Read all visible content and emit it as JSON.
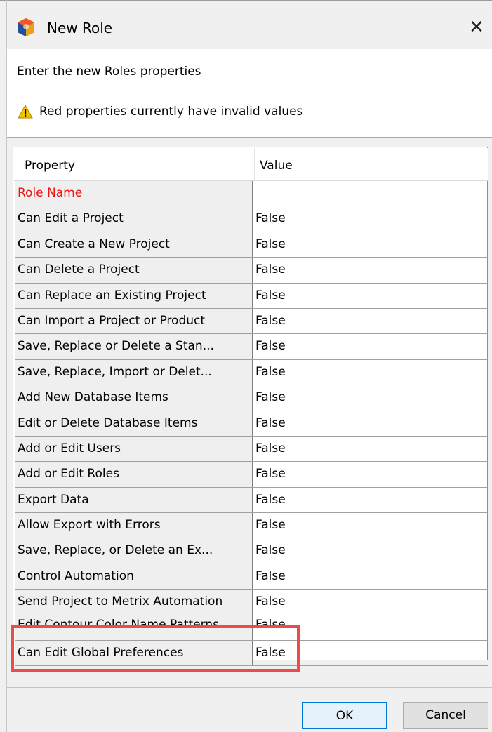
{
  "window": {
    "title": "New Role",
    "close_glyph": "✕",
    "icon": "app-logo-icon"
  },
  "header": {
    "subtitle": "Enter the new Roles properties",
    "warning_text": "Red properties currently have invalid values",
    "warning_icon": "warning-icon"
  },
  "table": {
    "columns": [
      "Property",
      "Value"
    ],
    "rows": [
      {
        "property": "Role Name",
        "value": "",
        "invalid": true
      },
      {
        "property": "Can Edit a Project",
        "value": "False"
      },
      {
        "property": "Can Create a New Project",
        "value": "False"
      },
      {
        "property": "Can Delete a Project",
        "value": "False"
      },
      {
        "property": "Can Replace an Existing Project",
        "value": "False"
      },
      {
        "property": "Can Import a Project or Product",
        "value": "False"
      },
      {
        "property": "Save, Replace or Delete a Stan...",
        "value": "False"
      },
      {
        "property": "Save, Replace, Import or Delet...",
        "value": "False"
      },
      {
        "property": "Add New Database Items",
        "value": "False"
      },
      {
        "property": "Edit or Delete Database Items",
        "value": "False"
      },
      {
        "property": "Add or Edit Users",
        "value": "False"
      },
      {
        "property": "Add or Edit Roles",
        "value": "False"
      },
      {
        "property": "Export Data",
        "value": "False"
      },
      {
        "property": "Allow Export with Errors",
        "value": "False"
      },
      {
        "property": "Save, Replace, or Delete an Ex...",
        "value": "False"
      },
      {
        "property": "Control Automation",
        "value": "False"
      },
      {
        "property": "Send Project to Metrix Automation",
        "value": "False"
      },
      {
        "property": "Edit Contour Color Name Patterns",
        "value": "False",
        "clipped": true
      },
      {
        "property": "Can Edit Global Preferences",
        "value": "False",
        "highlighted": true
      }
    ]
  },
  "buttons": {
    "ok": "OK",
    "cancel": "Cancel"
  },
  "colors": {
    "invalid_text": "#ee1111",
    "highlight_border": "#ef4a4a",
    "ok_border": "#0078d7"
  }
}
